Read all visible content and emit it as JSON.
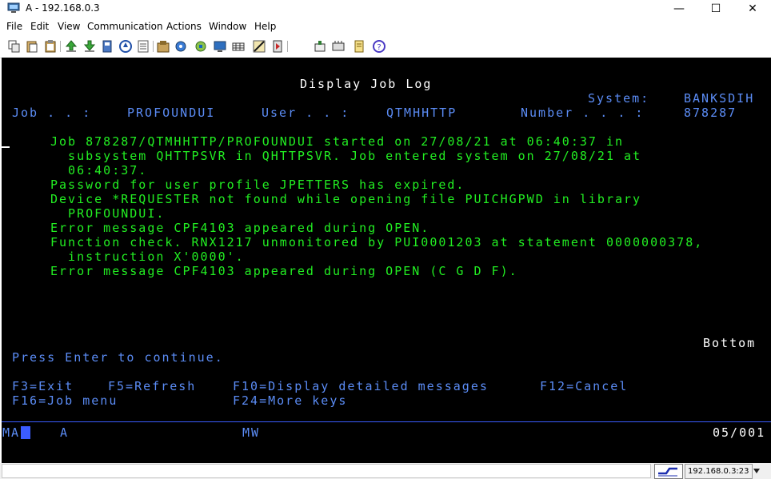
{
  "window": {
    "title": "A - 192.168.0.3",
    "minimize_glyph": "—",
    "maximize_glyph": "☐",
    "close_glyph": "✕"
  },
  "menu": [
    "File",
    "Edit",
    "View",
    "Communication",
    "Actions",
    "Window",
    "Help"
  ],
  "toolbar_icons": [
    "copy-icon",
    "paste-icon",
    "clipboard-icon",
    "send-file-icon",
    "receive-file-icon",
    "print-icon",
    "macro-icon",
    "notes-icon",
    "package-icon",
    "settings-icon",
    "network-icon",
    "display-icon",
    "keyboard-icon",
    "map-icon",
    "help-record-icon",
    "stop-record-icon",
    "play-icon",
    "edit-icon",
    "help-icon"
  ],
  "screen": {
    "title": "Display Job Log",
    "system_label": "System:",
    "system_value": "BANKSDIH",
    "job_label": "Job . . :",
    "job_value": "PROFOUNDUI",
    "user_label": "User . . :",
    "user_value": "QTMHHTTP",
    "number_label": "Number . . . :",
    "number_value": "878287",
    "messages": [
      "Job 878287/QTMHHTTP/PROFOUNDUI started on 27/08/21 at 06:40:37 in",
      "  subsystem QHTTPSVR in QHTTPSVR. Job entered system on 27/08/21 at",
      "  06:40:37.",
      "Password for user profile JPETTERS has expired.",
      "Device *REQUESTER not found while opening file PUICHGPWD in library",
      "  PROFOUNDUI.",
      "Error message CPF4103 appeared during OPEN.",
      "Function check. RNX1217 unmonitored by PUI0001203 at statement 0000000378,",
      "  instruction X'0000'.",
      "Error message CPF4103 appeared during OPEN (C G D F)."
    ],
    "bottom_indicator": "Bottom",
    "prompt": "Press Enter to continue.",
    "fkeys_row1": [
      "F3=Exit",
      "F5=Refresh",
      "F10=Display detailed messages",
      "F12=Cancel"
    ],
    "fkeys_row2": [
      "F16=Job menu",
      "F24=More keys"
    ]
  },
  "oia": {
    "session": "MA",
    "mode": "A",
    "indicator": "MW",
    "cursor_pos": "05/001"
  },
  "status": {
    "connection": "192.168.0.3:23"
  },
  "colors": {
    "screen_bg": "#000000",
    "green": "#22ee22",
    "blue": "#5b8cf5",
    "white": "#ffffff",
    "oia_blue": "#3b5cff"
  }
}
